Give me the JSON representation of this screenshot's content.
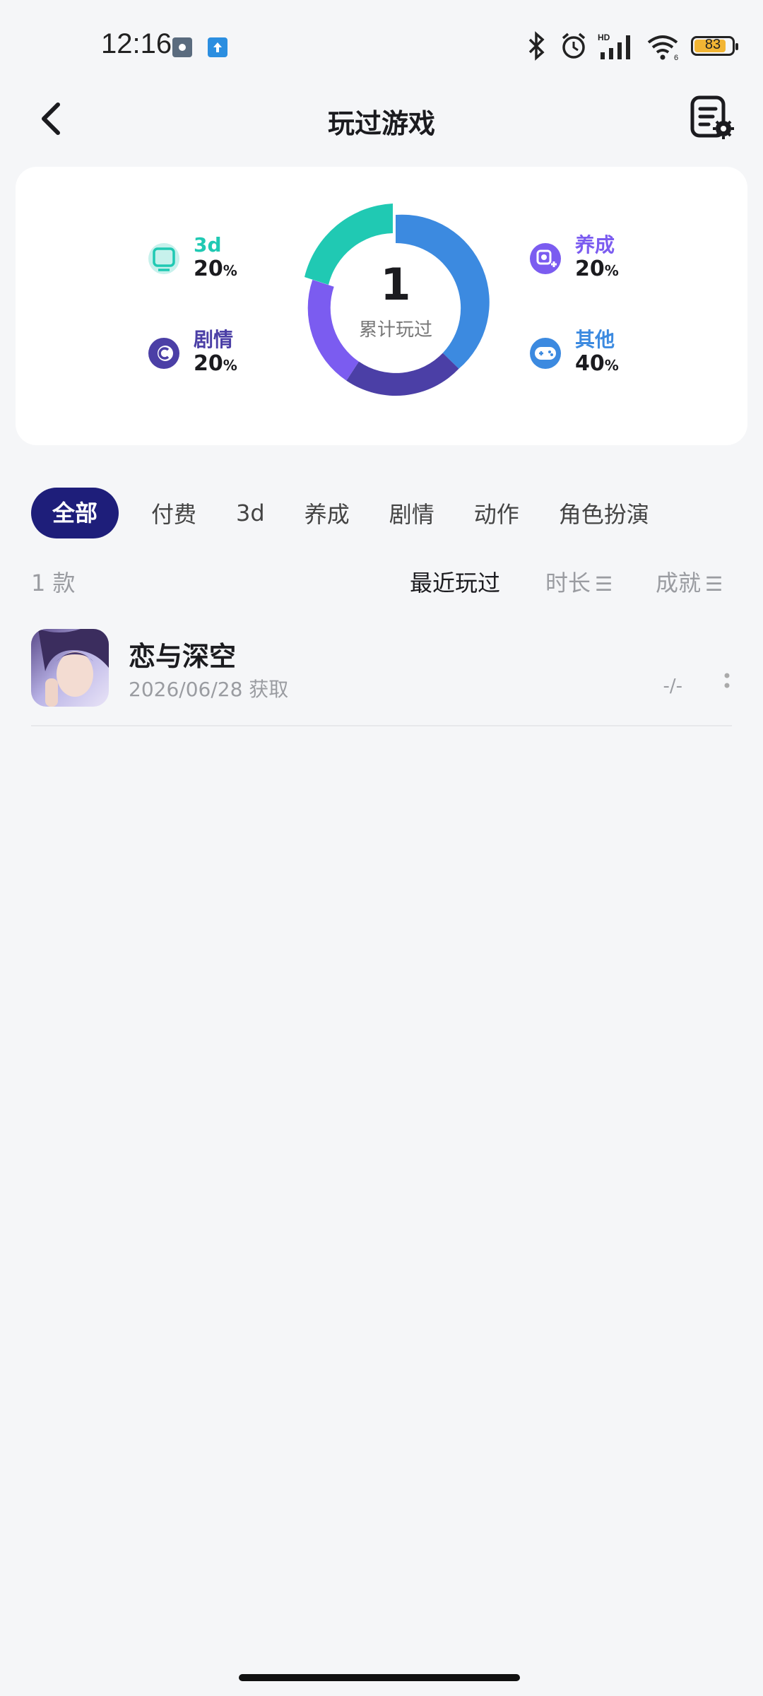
{
  "status_bar": {
    "time": "12:16",
    "battery": "83"
  },
  "header": {
    "title": "玩过游戏"
  },
  "stats": {
    "total": "1",
    "total_label": "累计玩过",
    "categories": [
      {
        "name": "3d",
        "percent": "20",
        "color": "#20c9b3"
      },
      {
        "name": "剧情",
        "percent": "20",
        "color": "#4b3fa6"
      },
      {
        "name": "养成",
        "percent": "20",
        "color": "#7b5cf0"
      },
      {
        "name": "其他",
        "percent": "40",
        "color": "#3c8ae0"
      }
    ],
    "percent_sign": "%"
  },
  "tabs": [
    "全部",
    "付费",
    "3d",
    "养成",
    "剧情",
    "动作",
    "角色扮演"
  ],
  "list_header": {
    "count": "1 款",
    "sort_recent": "最近玩过",
    "sort_duration": "时长",
    "sort_achievement": "成就"
  },
  "games": [
    {
      "name": "恋与深空",
      "date": "2026/06/28 获取",
      "duration": "-/-"
    }
  ],
  "colors": {
    "accent": "#1e1e7a",
    "background": "#f5f6f8"
  }
}
